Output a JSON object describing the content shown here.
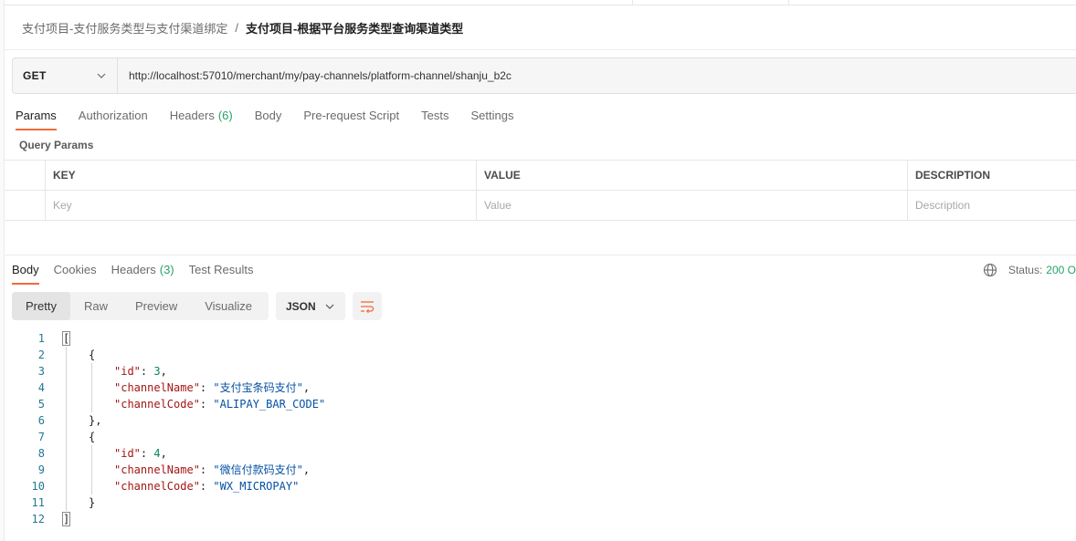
{
  "breadcrumb": {
    "parent": "支付项目-支付服务类型与支付渠道绑定",
    "separator": "/",
    "current": "支付项目-根据平台服务类型查询渠道类型"
  },
  "request": {
    "method": "GET",
    "url": "http://localhost:57010/merchant/my/pay-channels/platform-channel/shanju_b2c"
  },
  "request_tabs": [
    {
      "label": "Params",
      "count": ""
    },
    {
      "label": "Authorization",
      "count": ""
    },
    {
      "label": "Headers",
      "count": "(6)"
    },
    {
      "label": "Body",
      "count": ""
    },
    {
      "label": "Pre-request Script",
      "count": ""
    },
    {
      "label": "Tests",
      "count": ""
    },
    {
      "label": "Settings",
      "count": ""
    }
  ],
  "query_params": {
    "title": "Query Params",
    "headers": [
      "KEY",
      "VALUE",
      "DESCRIPTION"
    ],
    "placeholders": [
      "Key",
      "Value",
      "Description"
    ]
  },
  "response_tabs": [
    {
      "label": "Body",
      "count": ""
    },
    {
      "label": "Cookies",
      "count": ""
    },
    {
      "label": "Headers",
      "count": "(3)"
    },
    {
      "label": "Test Results",
      "count": ""
    }
  ],
  "status": {
    "label": "Status:",
    "value": "200 O"
  },
  "view_modes": [
    "Pretty",
    "Raw",
    "Preview",
    "Visualize"
  ],
  "format": "JSON",
  "icons": {
    "method_dropdown": "chevron-down-icon",
    "format_dropdown": "chevron-down-icon",
    "wrap": "wrap-lines-icon",
    "network": "globe-icon"
  },
  "colors": {
    "accent": "#f26b3a",
    "success": "#26a269",
    "json_key": "#a31515",
    "json_string": "#0451a5",
    "json_number": "#098658",
    "line_number": "#237893"
  },
  "response_lines": [
    {
      "num": "1",
      "open": "[",
      "key": "",
      "num_val": "",
      "str_val": "",
      "close": ""
    },
    {
      "num": "2",
      "open": "{",
      "key": "",
      "num_val": "",
      "str_val": "",
      "close": ""
    },
    {
      "num": "3",
      "open": "",
      "key": "\"id\"",
      "num_val": "3",
      "str_val": "",
      "close": ","
    },
    {
      "num": "4",
      "open": "",
      "key": "\"channelName\"",
      "num_val": "",
      "str_val": "\"支付宝条码支付\"",
      "close": ","
    },
    {
      "num": "5",
      "open": "",
      "key": "\"channelCode\"",
      "num_val": "",
      "str_val": "\"ALIPAY_BAR_CODE\"",
      "close": ""
    },
    {
      "num": "6",
      "open": "},",
      "key": "",
      "num_val": "",
      "str_val": "",
      "close": ""
    },
    {
      "num": "7",
      "open": "{",
      "key": "",
      "num_val": "",
      "str_val": "",
      "close": ""
    },
    {
      "num": "8",
      "open": "",
      "key": "\"id\"",
      "num_val": "4",
      "str_val": "",
      "close": ","
    },
    {
      "num": "9",
      "open": "",
      "key": "\"channelName\"",
      "num_val": "",
      "str_val": "\"微信付款码支付\"",
      "close": ","
    },
    {
      "num": "10",
      "open": "",
      "key": "\"channelCode\"",
      "num_val": "",
      "str_val": "\"WX_MICROPAY\"",
      "close": ""
    },
    {
      "num": "11",
      "open": "}",
      "key": "",
      "num_val": "",
      "str_val": "",
      "close": ""
    },
    {
      "num": "12",
      "open": "]",
      "key": "",
      "num_val": "",
      "str_val": "",
      "close": ""
    }
  ]
}
